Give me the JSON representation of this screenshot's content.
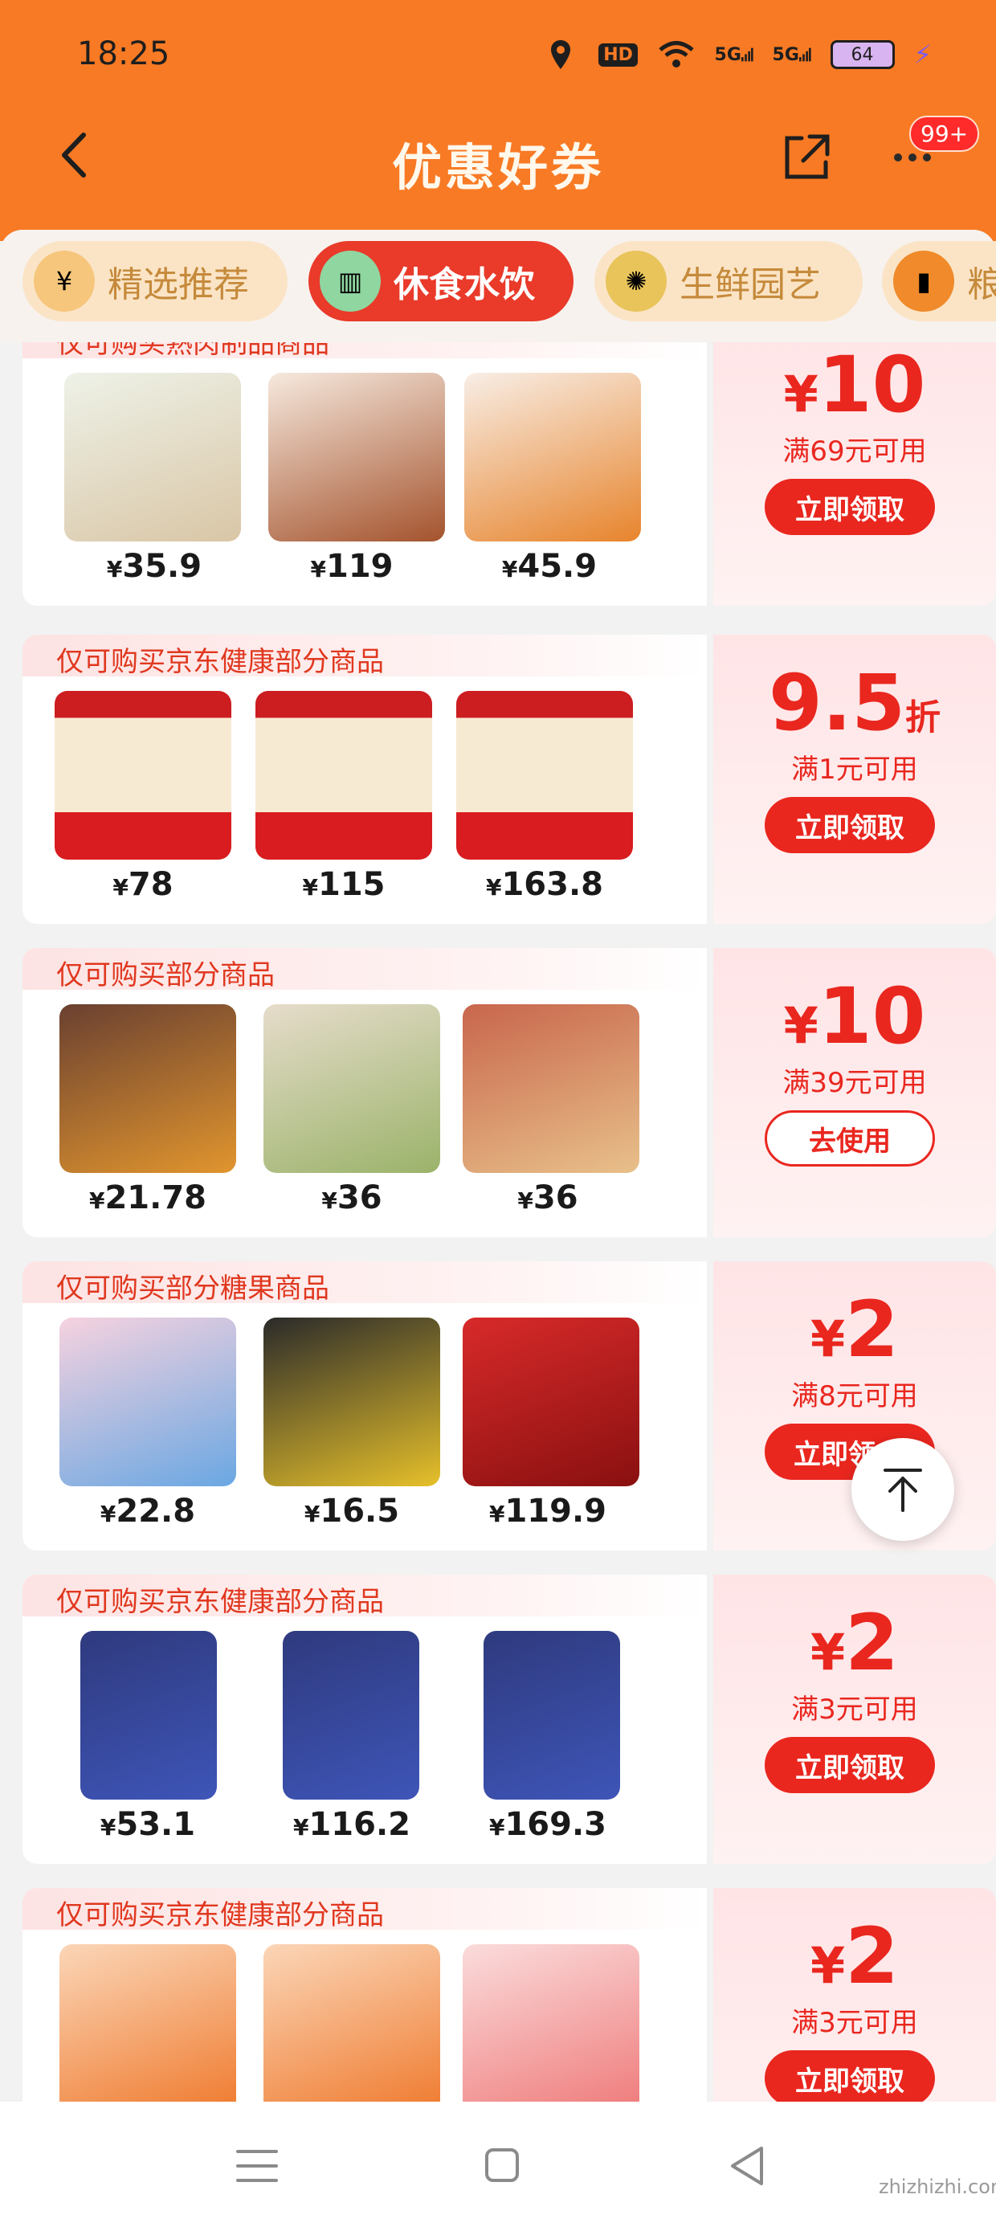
{
  "status_bar": {
    "time": "18:25",
    "hd_label": "HD",
    "signal_1": "5G",
    "signal_2": "5G",
    "battery": "64"
  },
  "nav": {
    "title": "优惠好券",
    "more_badge": "99+"
  },
  "tabs": [
    {
      "label": "精选推荐",
      "icon": "coupon-icon",
      "active": false
    },
    {
      "label": "休食水饮",
      "icon": "snack-bag-icon",
      "active": true
    },
    {
      "label": "生鲜园艺",
      "icon": "durian-icon",
      "active": false
    },
    {
      "label": "粮",
      "icon": "grain-bag-icon",
      "active": false
    }
  ],
  "coupons": [
    {
      "desc": "仅可购买熟肉制品商品",
      "prices": [
        "35.9",
        "119",
        "45.9"
      ],
      "amount_symbol": "¥",
      "amount": "10",
      "amount_unit": "",
      "condition": "满69元可用",
      "button": "立即领取",
      "button_style": "filled"
    },
    {
      "desc": "仅可购买京东健康部分商品",
      "prices": [
        "78",
        "115",
        "163.8"
      ],
      "amount_symbol": "",
      "amount": "9.5",
      "amount_unit": "折",
      "condition": "满1元可用",
      "button": "立即领取",
      "button_style": "filled"
    },
    {
      "desc": "仅可购买部分商品",
      "prices": [
        "21.78",
        "36",
        "36"
      ],
      "amount_symbol": "¥",
      "amount": "10",
      "amount_unit": "",
      "condition": "满39元可用",
      "button": "去使用",
      "button_style": "outline"
    },
    {
      "desc": "仅可购买部分糖果商品",
      "prices": [
        "22.8",
        "16.5",
        "119.9"
      ],
      "amount_symbol": "¥",
      "amount": "2",
      "amount_unit": "",
      "condition": "满8元可用",
      "button": "立即领",
      "button_style": "filled"
    },
    {
      "desc": "仅可购买京东健康部分商品",
      "prices": [
        "53.1",
        "116.2",
        "169.3"
      ],
      "amount_symbol": "¥",
      "amount": "2",
      "amount_unit": "",
      "condition": "满3元可用",
      "button": "立即领取",
      "button_style": "filled"
    },
    {
      "desc": "仅可购买京东健康部分商品",
      "prices": [
        "",
        "",
        ""
      ],
      "amount_symbol": "¥",
      "amount": "2",
      "amount_unit": "",
      "condition": "满3元可用",
      "button": "立即领取",
      "button_style": "filled"
    }
  ],
  "currency": "¥",
  "watermark": "zhizhizhi.com",
  "colors": {
    "header": "#f87a24",
    "accent_red": "#e9271f",
    "tab_active": "#e93a2a",
    "tab_inactive": "#fbe4c6"
  }
}
